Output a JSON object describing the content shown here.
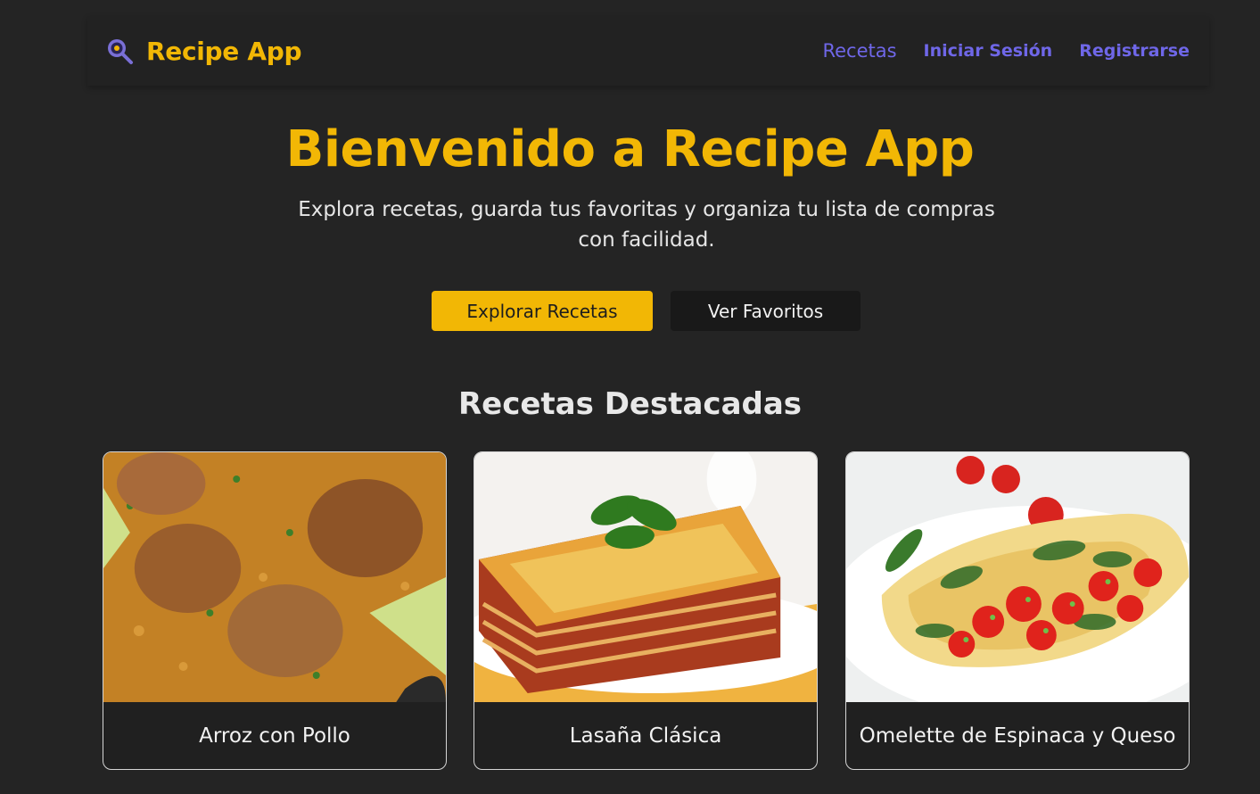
{
  "brand": {
    "name": "Recipe App",
    "icon": "magnifier-pan-icon"
  },
  "nav": {
    "links": [
      {
        "label": "Recetas",
        "active": true
      },
      {
        "label": "Iniciar Sesión",
        "active": false
      },
      {
        "label": "Registrarse",
        "active": false
      }
    ]
  },
  "hero": {
    "title": "Bienvenido a Recipe App",
    "subtitle": "Explora recetas, guarda tus favoritas y organiza tu lista de compras con facilidad.",
    "primary_button": "Explorar Recetas",
    "secondary_button": "Ver Favoritos"
  },
  "featured": {
    "title": "Recetas Destacadas",
    "recipes": [
      {
        "name": "Arroz con Pollo",
        "image": "chicken-rice-photo"
      },
      {
        "name": "Lasaña Clásica",
        "image": "lasagna-photo"
      },
      {
        "name": "Omelette de Espinaca y Queso",
        "image": "spinach-omelette-photo"
      }
    ]
  },
  "colors": {
    "background": "#242424",
    "accent": "#f2b705",
    "link": "#6f67e8"
  }
}
